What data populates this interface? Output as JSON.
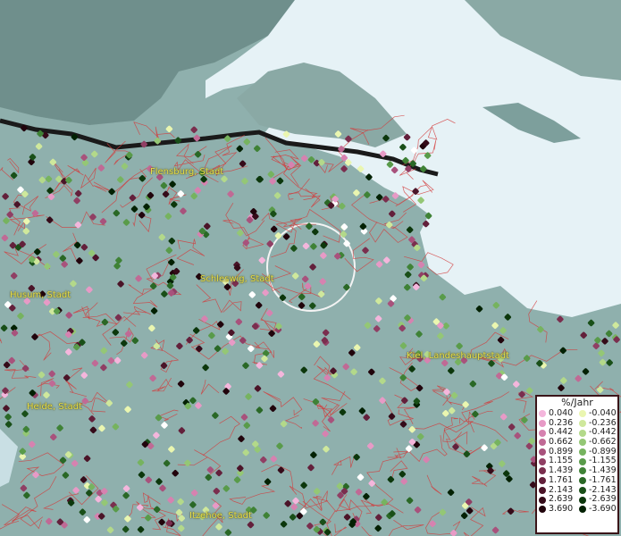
{
  "map": {
    "cities": [
      {
        "id": "flensburg",
        "label": "Flensburg, Stadt"
      },
      {
        "id": "husum",
        "label": "Husum, Stadt"
      },
      {
        "id": "schleswig",
        "label": "Schleswig, Stadt"
      },
      {
        "id": "kiel",
        "label": "Kiel, Landeshauptstadt"
      },
      {
        "id": "heide",
        "label": "Heide, Stadt"
      },
      {
        "id": "itzehoe",
        "label": "Itzehoe, Stadt"
      }
    ]
  },
  "legend": {
    "title": "%/Jahr",
    "positive": [
      {
        "label": "0.040",
        "color": "#f4b6dc"
      },
      {
        "label": "0.236",
        "color": "#e79ac6"
      },
      {
        "label": "0.442",
        "color": "#d682b0"
      },
      {
        "label": "0.662",
        "color": "#c06a95"
      },
      {
        "label": "0.899",
        "color": "#a8527c"
      },
      {
        "label": "1.155",
        "color": "#903f64"
      },
      {
        "label": "1.439",
        "color": "#7a2e4e"
      },
      {
        "label": "1.761",
        "color": "#63203b"
      },
      {
        "label": "2.143",
        "color": "#4b1428"
      },
      {
        "label": "2.639",
        "color": "#350b19"
      },
      {
        "label": "3.690",
        "color": "#21040c"
      }
    ],
    "negative": [
      {
        "label": "-0.040",
        "color": "#eaf6b0"
      },
      {
        "label": "-0.236",
        "color": "#cfe89c"
      },
      {
        "label": "-0.442",
        "color": "#b3d98a"
      },
      {
        "label": "-0.662",
        "color": "#94c775"
      },
      {
        "label": "-0.899",
        "color": "#76b35f"
      },
      {
        "label": "-1.155",
        "color": "#599b4a"
      },
      {
        "label": "-1.439",
        "color": "#3f8236"
      },
      {
        "label": "-1.761",
        "color": "#2a6826"
      },
      {
        "label": "-2.143",
        "color": "#194f18"
      },
      {
        "label": "-2.639",
        "color": "#0c370c"
      },
      {
        "label": "-3.690",
        "color": "#032103"
      }
    ]
  }
}
